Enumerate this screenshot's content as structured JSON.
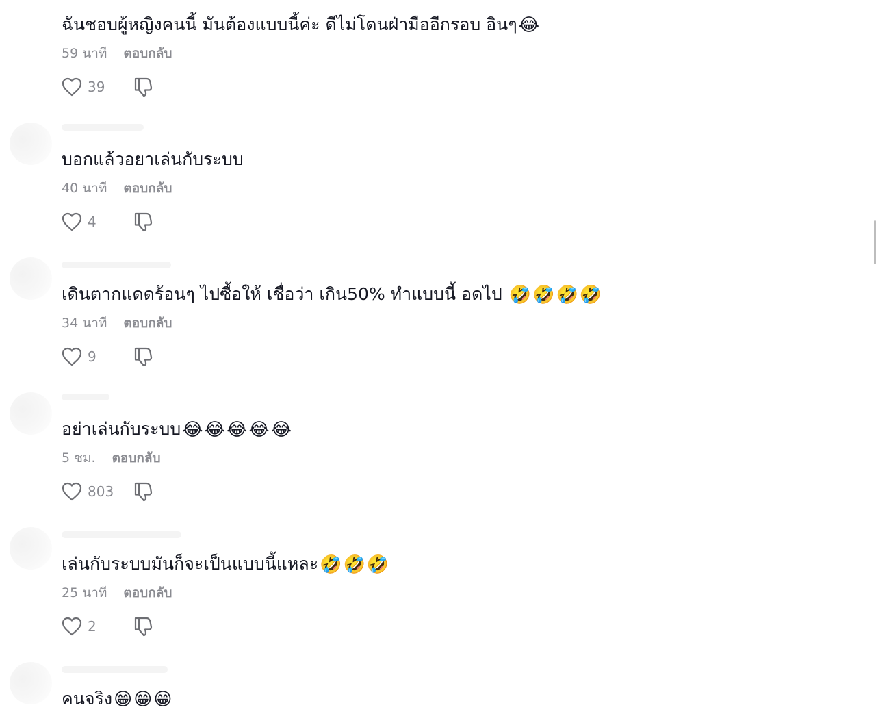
{
  "comments": [
    {
      "text": "ฉันชอบผู้หญิงคนนี้ มันต้องแบบนี้ค่ะ ดีไม่โดนฝ่ามืออีกรอบ อินๆ",
      "emojis": "😂",
      "time": "59 นาที",
      "reply": "ตอบกลับ",
      "likes": "39"
    },
    {
      "text": "บอกแล้วอยาเล่นกับระบบ",
      "emojis": "",
      "time": "40 นาที",
      "reply": "ตอบกลับ",
      "likes": "4"
    },
    {
      "text": "เดินตากแดดร้อนๆ ไปซื้อให้ เชื่อว่า เกิน50% ทำแบบนี้ อดไป ",
      "emojis": "🤣🤣🤣🤣",
      "time": "34 นาที",
      "reply": "ตอบกลับ",
      "likes": "9"
    },
    {
      "text": "อย่าเล่นกับระบบ",
      "emojis": "😂😂😂😂😂",
      "time": "5 ชม.",
      "reply": "ตอบกลับ",
      "likes": "803"
    },
    {
      "text": "เล่นกับระบบมันก็จะเป็นแบบนี้แหละ",
      "emojis": "🤣🤣🤣",
      "time": "25 นาที",
      "reply": "ตอบกลับ",
      "likes": "2"
    },
    {
      "text": "คนจริง",
      "emojis": "😁😁😁",
      "time": "",
      "reply": "",
      "likes": ""
    }
  ],
  "icons": {
    "like": "heart-outline-icon",
    "dislike": "thumbs-down-outline-icon"
  },
  "colors": {
    "text": "#161823",
    "meta": "#8a8b91",
    "background": "#ffffff"
  }
}
